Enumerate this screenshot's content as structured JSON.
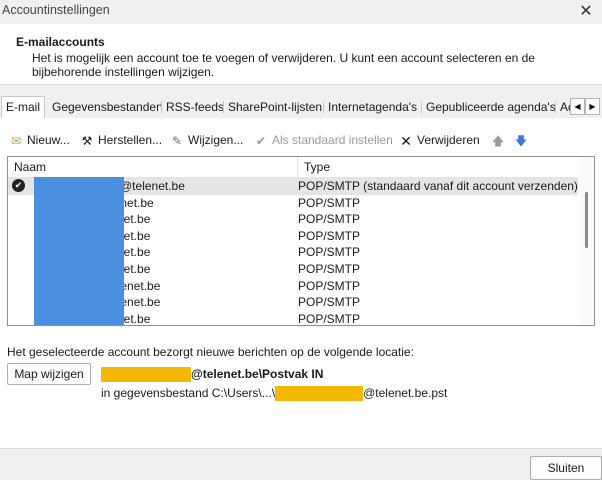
{
  "window": {
    "title": "Accountinstellingen",
    "close_glyph": "✕"
  },
  "header": {
    "title": "E-mailaccounts",
    "description": "Het is mogelijk een account toe te voegen of verwijderen. U kunt een account selecteren en de bijbehorende instellingen wijzigen."
  },
  "tabs": [
    {
      "label": "E-mail",
      "active": true
    },
    {
      "label": "Gegevensbestanden"
    },
    {
      "label": "RSS-feeds"
    },
    {
      "label": "SharePoint-lijsten"
    },
    {
      "label": "Internetagenda's"
    },
    {
      "label": "Gepubliceerde agenda's"
    },
    {
      "label": "Ad"
    }
  ],
  "tab_scroll": {
    "left": "◀",
    "right": "▶"
  },
  "toolbar": {
    "new": {
      "label": "Nieuw...",
      "icon": "new-mail-icon",
      "glyph": "✉"
    },
    "repair": {
      "label": "Herstellen...",
      "icon": "repair-icon",
      "glyph": "⚒"
    },
    "change": {
      "label": "Wijzigen...",
      "icon": "change-icon",
      "glyph": "✎"
    },
    "default": {
      "label": "Als standaard instellen",
      "icon": "default-check-icon",
      "glyph": "✔",
      "disabled": true
    },
    "remove": {
      "label": "Verwijderen",
      "icon": "remove-icon",
      "glyph": "✕"
    },
    "up": {
      "icon": "move-up-icon",
      "glyph": "🡅",
      "color": "#9a9a9a"
    },
    "down": {
      "icon": "move-down-icon",
      "glyph": "🡇",
      "color": "#3b78d8"
    }
  },
  "accounts": {
    "columns": {
      "name": "Naam",
      "type": "Type"
    },
    "rows": [
      {
        "name": "@telenet.be",
        "type": "POP/SMTP (standaard vanaf dit account verzenden)",
        "default": true
      },
      {
        "name": "lenet.be",
        "type": "POP/SMTP"
      },
      {
        "name": "net.be",
        "type": "POP/SMTP"
      },
      {
        "name": "net.be",
        "type": "POP/SMTP"
      },
      {
        "name": "net.be",
        "type": "POP/SMTP"
      },
      {
        "name": "net.be",
        "type": "POP/SMTP"
      },
      {
        "name": "elenet.be",
        "type": "POP/SMTP"
      },
      {
        "name": "elenet.be",
        "type": "POP/SMTP"
      },
      {
        "name": "net.be",
        "type": "POP/SMTP"
      }
    ],
    "redaction_color": "#4a8fe0"
  },
  "location": {
    "text": "Het geselecteerde account bezorgt nieuwe berichten op de volgende locatie:",
    "change_folder_label": "Map wijzigen",
    "folder_suffix": "@telenet.be\\Postvak IN",
    "datafile_prefix": "in gegevensbestand C:\\Users\\...\\",
    "datafile_suffix": "@telenet.be.pst",
    "redaction_color": "#f5b800"
  },
  "footer": {
    "close_label": "Sluiten"
  }
}
